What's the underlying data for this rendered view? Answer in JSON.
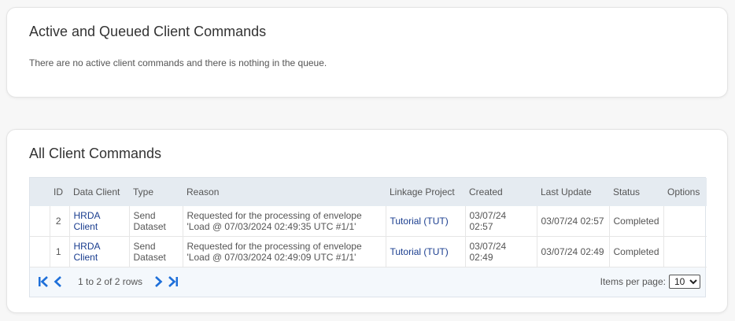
{
  "active_section": {
    "title": "Active and Queued Client Commands",
    "message": "There are no active client commands and there is nothing in the queue."
  },
  "all_section": {
    "title": "All Client Commands",
    "columns": {
      "id": "ID",
      "data_client": "Data Client",
      "type": "Type",
      "reason": "Reason",
      "linkage_project": "Linkage Project",
      "created": "Created",
      "last_update": "Last Update",
      "status": "Status",
      "options": "Options"
    },
    "rows": [
      {
        "id": "2",
        "data_client": "HRDA Client",
        "type": "Send Dataset",
        "reason": "Requested for the processing of envelope 'Load @ 07/03/2024 02:49:35 UTC #1/1'",
        "linkage_project": "Tutorial (TUT)",
        "created": "03/07/24 02:57",
        "last_update": "03/07/24 02:57",
        "status": "Completed",
        "options": ""
      },
      {
        "id": "1",
        "data_client": "HRDA Client",
        "type": "Send Dataset",
        "reason": "Requested for the processing of envelope 'Load @ 07/03/2024 02:49:09 UTC #1/1'",
        "linkage_project": "Tutorial (TUT)",
        "created": "03/07/24 02:49",
        "last_update": "03/07/24 02:49",
        "status": "Completed",
        "options": ""
      }
    ],
    "pager": {
      "rows_info": "1 to 2 of 2 rows",
      "items_per_page_label": "Items per page:",
      "items_per_page_value": "10",
      "icon_color": "#1e6fd9"
    }
  }
}
